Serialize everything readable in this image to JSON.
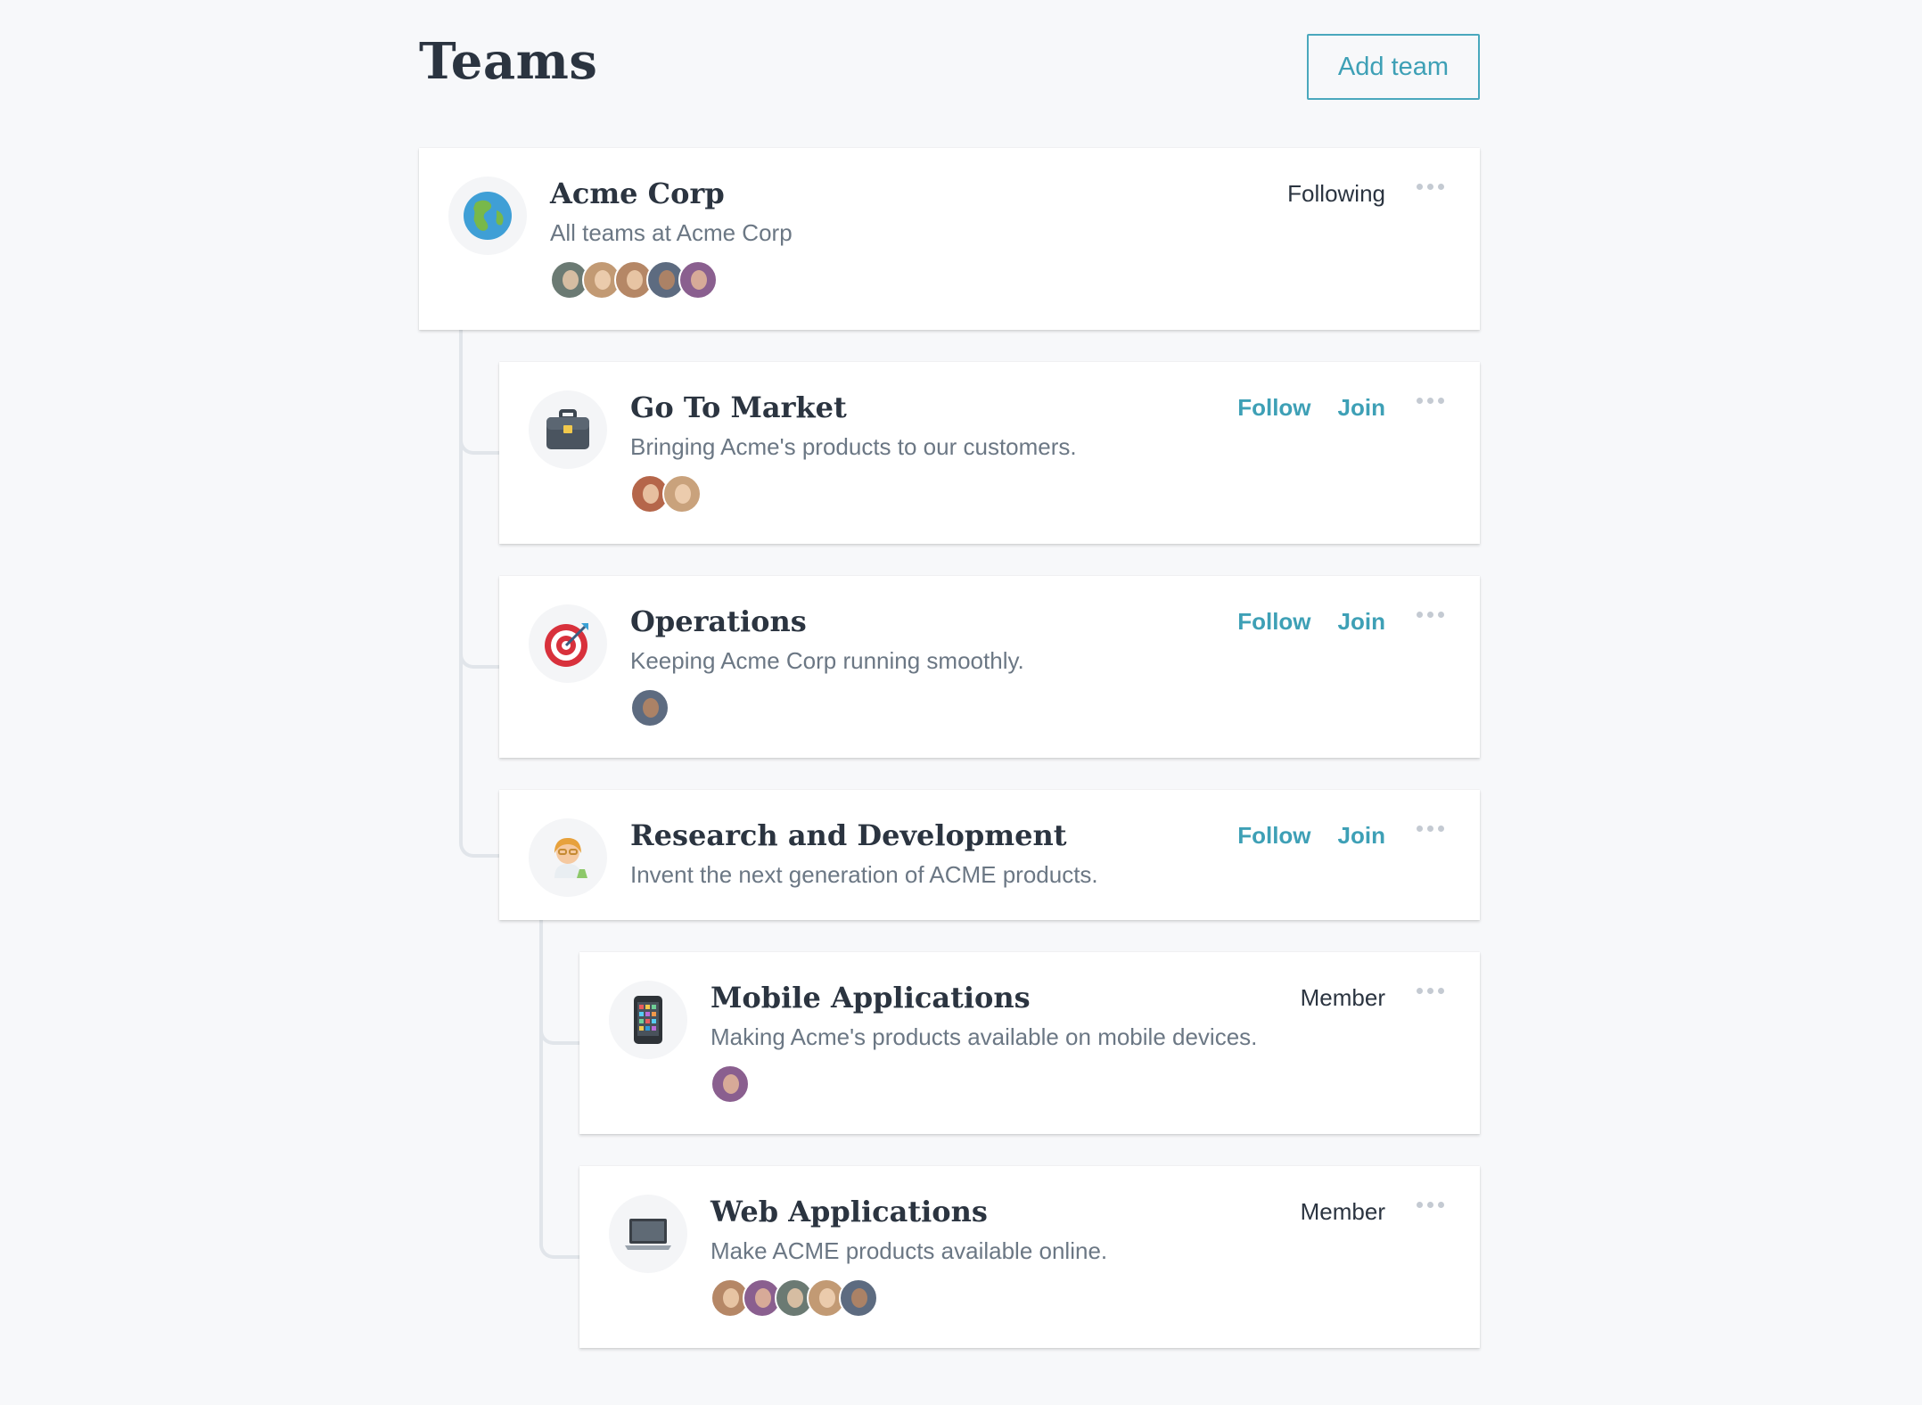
{
  "header": {
    "title": "Teams",
    "add_team_label": "Add team"
  },
  "teams": [
    {
      "name": "Acme Corp",
      "description": "All teams at Acme Corp",
      "icon": "globe-icon",
      "status": "Following",
      "avatar_colors": [
        "#6b7a73",
        "#c29a74",
        "#b58766",
        "#5d6b80",
        "#8a5f8f"
      ]
    },
    {
      "name": "Go To Market",
      "description": "Bringing Acme's products to our customers.",
      "icon": "briefcase-icon",
      "follow_label": "Follow",
      "join_label": "Join",
      "avatar_colors": [
        "#b5664a",
        "#c9a27c"
      ]
    },
    {
      "name": "Operations",
      "description": "Keeping Acme Corp running smoothly.",
      "icon": "target-icon",
      "follow_label": "Follow",
      "join_label": "Join",
      "avatar_colors": [
        "#5d6b80"
      ]
    },
    {
      "name": "Research and Development",
      "description": "Invent the next generation of ACME products.",
      "icon": "scientist-icon",
      "follow_label": "Follow",
      "join_label": "Join",
      "avatar_colors": []
    },
    {
      "name": "Mobile Applications",
      "description": "Making Acme's products available on mobile devices.",
      "icon": "mobile-phone-icon",
      "status": "Member",
      "avatar_colors": [
        "#8a5f8f"
      ]
    },
    {
      "name": "Web Applications",
      "description": "Make ACME products available online.",
      "icon": "laptop-icon",
      "status": "Member",
      "avatar_colors": [
        "#b58766",
        "#8a5f8f",
        "#6b7a73",
        "#c29a74",
        "#5d6b80"
      ]
    }
  ],
  "colors": {
    "accent": "#3ea0b6",
    "background": "#f7f8fa",
    "text": "#2b3440",
    "muted": "#6b7784"
  }
}
